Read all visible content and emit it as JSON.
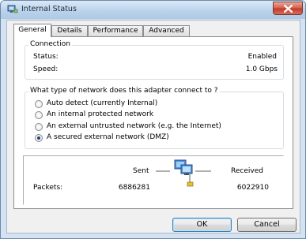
{
  "window": {
    "title": "Internal Status"
  },
  "tabs": [
    {
      "label": "General"
    },
    {
      "label": "Details"
    },
    {
      "label": "Performance"
    },
    {
      "label": "Advanced"
    }
  ],
  "connection": {
    "title": "Connection",
    "status_label": "Status:",
    "status_value": "Enabled",
    "speed_label": "Speed:",
    "speed_value": "1.0 Gbps"
  },
  "network_type": {
    "question": "What type of network does this adapter connect to ?",
    "options": [
      {
        "label": "Auto detect (currently Internal)",
        "checked": false
      },
      {
        "label": "An internal protected network",
        "checked": false
      },
      {
        "label": "An external untrusted network (e.g. the Internet)",
        "checked": false
      },
      {
        "label": "A secured external network (DMZ)",
        "checked": true
      }
    ]
  },
  "activity": {
    "sent_label": "Sent",
    "received_label": "Received",
    "packets_label": "Packets:",
    "packets_sent": "6886281",
    "packets_received": "6022910"
  },
  "buttons": {
    "ok": "OK",
    "cancel": "Cancel"
  },
  "icons": {
    "title": "network-adapter-icon",
    "close": "close-x-icon",
    "activity": "network-computers-icon"
  }
}
